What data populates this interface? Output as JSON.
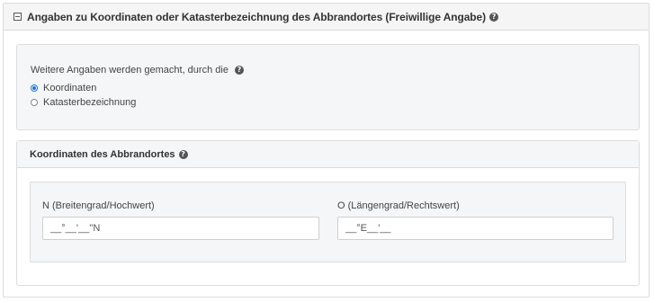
{
  "panel": {
    "title": "Angaben zu Koordinaten oder Katasterbezeichnung des Abbrandortes (Freiwillige Angabe)",
    "help_glyph": "?"
  },
  "method": {
    "question": "Weitere Angaben werden gemacht, durch die",
    "help_glyph": "?",
    "options": [
      {
        "label": "Koordinaten",
        "selected": true
      },
      {
        "label": "Katasterbezeichnung",
        "selected": false
      }
    ]
  },
  "coordinates": {
    "title": "Koordinaten des Abbrandortes",
    "help_glyph": "?",
    "north": {
      "label": "N (Breitengrad/Hochwert)",
      "value": "__°__'__''N"
    },
    "east": {
      "label": "O (Längengrad/Rechtswert)",
      "value": "__°E__'__"
    }
  },
  "colors": {
    "accent": "#1a73e8",
    "border": "#dcdcdc",
    "panel_bg": "#f5f6f8"
  },
  "icons": {
    "collapse": "collapse-icon",
    "help": "help-icon"
  }
}
